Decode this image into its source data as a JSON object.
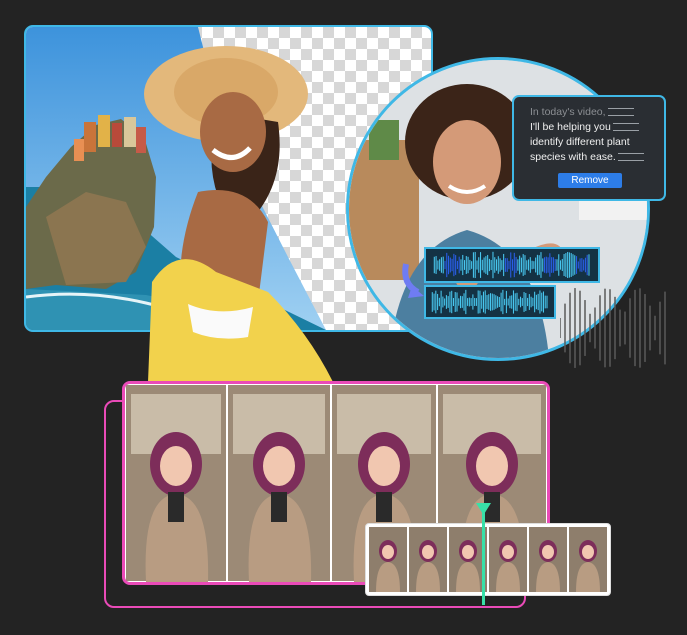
{
  "transcript": {
    "line1": "In today's video,",
    "line2": "I'll be helping you",
    "line3": "identify different plant",
    "line4": "species with ease.",
    "remove_button": "Remove"
  },
  "colors": {
    "background": "#232323",
    "accent_blue": "#3fb8e6",
    "accent_pink": "#ea4bb8",
    "playhead_green": "#38e0a8",
    "button_blue": "#2d7de8"
  },
  "icons": {
    "wave_arrow": "arrow-down-right-icon"
  }
}
